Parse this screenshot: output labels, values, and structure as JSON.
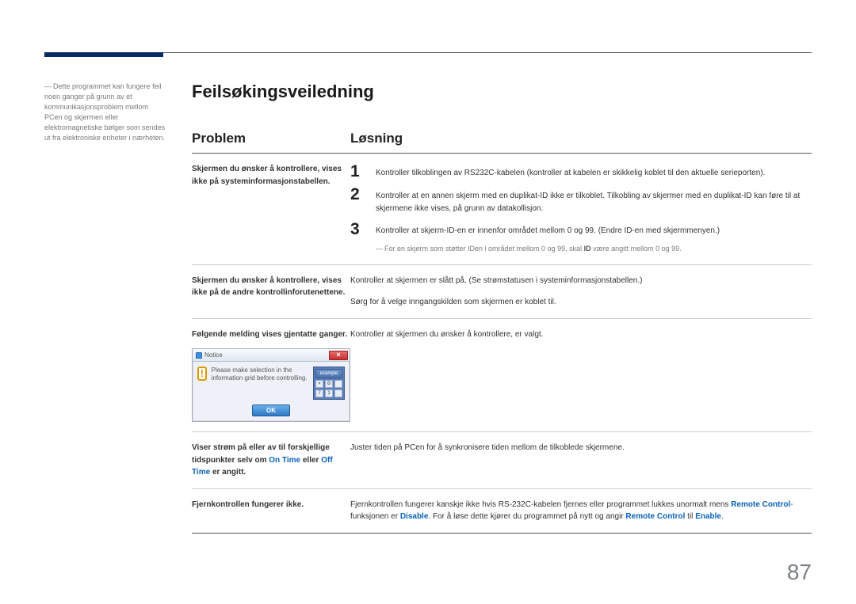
{
  "page_number": "87",
  "title": "Feilsøkingsveiledning",
  "sidenote": "Dette programmet kan fungere feil noen ganger på grunn av et kommunikasjonsproblem mellom PCen og skjermen eller elektromagnetiske bølger som sendes ut fra elektroniske enheter i nærheten.",
  "table": {
    "headers": {
      "problem": "Problem",
      "solution": "Løsning"
    },
    "rows": {
      "r1": {
        "problem": "Skjermen du ønsker å kontrollere, vises ikke på systeminformasjonstabellen.",
        "steps": {
          "s1": "Kontroller tilkoblingen av RS232C-kabelen (kontroller at kabelen er skikkelig koblet til den aktuelle serieporten).",
          "s2": "Kontroller at en annen skjerm med en duplikat-ID ikke er tilkoblet. Tilkobling av skjermer med en duplikat-ID kan føre til at skjermene ikke vises, på grunn av datakollisjon.",
          "s3": "Kontroller at skjerm-ID-en er innenfor området mellom 0 og 99. (Endre ID-en med skjermmenyen.)",
          "note_pre": "For en skjerm som støtter IDen i området mellom 0 og 99, skal ",
          "note_bold": "ID",
          "note_post": " være angitt mellom 0 og 99."
        }
      },
      "r2": {
        "problem": "Skjermen du ønsker å kontrollere, vises ikke på de andre kontrollinforutenettene.",
        "sol_l1": "Kontroller at skjermen er slått på. (Se strømstatusen i systeminformasjonstabellen.)",
        "sol_l2": "Sørg for å velge inngangskilden som skjermen er koblet til."
      },
      "r3": {
        "problem": "Følgende melding vises gjentatte ganger.",
        "solution": "Kontroller at skjermen du ønsker å kontrollere, er valgt.",
        "dialog": {
          "title": "Notice",
          "message": "Please make selection in the information grid before controlling.",
          "ok": "OK",
          "example": "example"
        }
      },
      "r4": {
        "problem_p1": "Viser strøm på eller av til forskjellige tidspunkter selv om ",
        "problem_on": "On Time",
        "problem_mid": " eller ",
        "problem_off": "Off Time",
        "problem_p2": " er angitt.",
        "solution": "Juster tiden på PCen for å synkronisere tiden mellom de tilkoblede skjermene."
      },
      "r5": {
        "problem": "Fjernkontrollen fungerer ikke.",
        "sol_a": "Fjernkontrollen fungerer kanskje ikke hvis RS-232C-kabelen fjernes eller programmet lukkes unormalt mens ",
        "remote_control": "Remote Control",
        "sol_b": "-funksjonen er ",
        "disable": "Disable",
        "sol_c": ". For å løse dette kjører du programmet på nytt og angir ",
        "sol_d": " til ",
        "enable": "Enable",
        "period": "."
      }
    }
  }
}
